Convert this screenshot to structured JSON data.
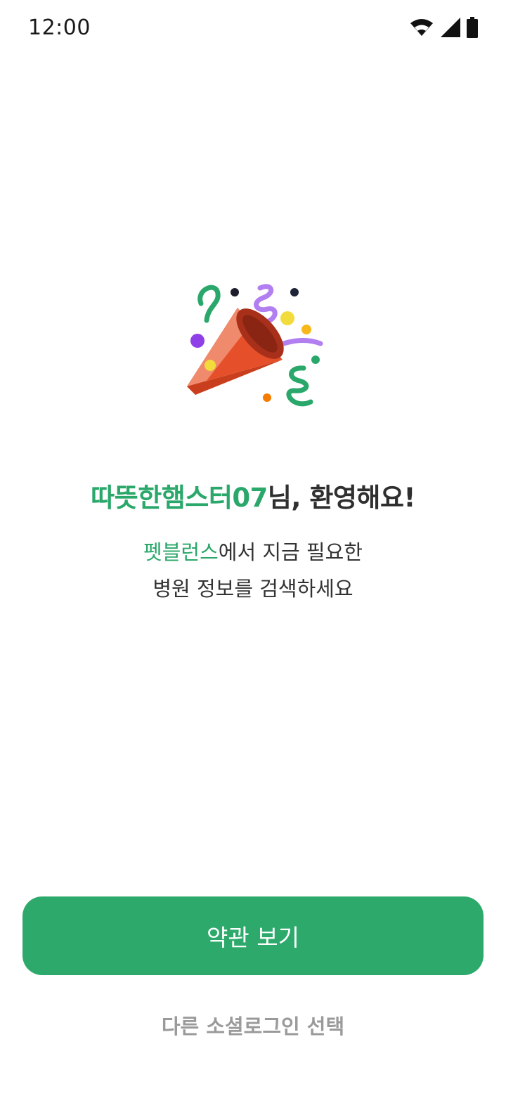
{
  "status_bar": {
    "time": "12:00",
    "icons": [
      "wifi-icon",
      "cellular-signal-icon",
      "battery-icon"
    ]
  },
  "hero": {
    "icon": "party-popper-icon"
  },
  "welcome": {
    "nickname": "따뜻한햄스터07",
    "suffix": "님, 환영해요!"
  },
  "subtitle": {
    "brand": "펫블런스",
    "line1_rest": "에서 지금 필요한",
    "line2": "병원 정보를 검색하세요"
  },
  "actions": {
    "primary_label": "약관 보기",
    "secondary_label": "다른 소셜로그인 선택"
  },
  "colors": {
    "accent": "#2daa6b",
    "accent_text": "#2aa76a",
    "secondary_text": "#9a9a9a"
  }
}
